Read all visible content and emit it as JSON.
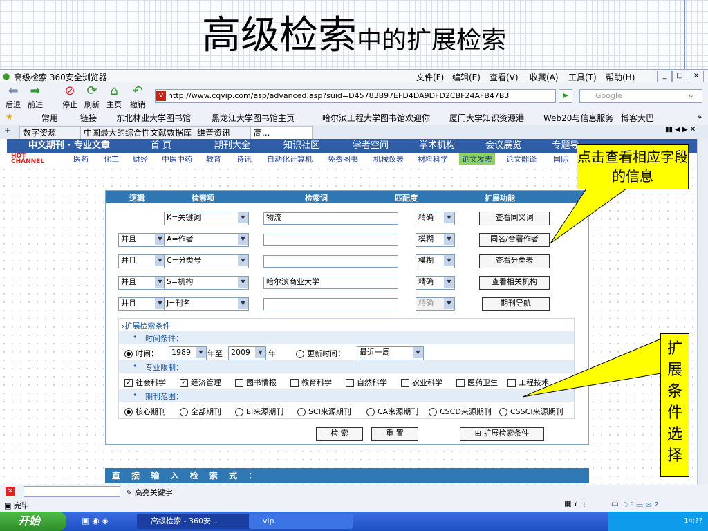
{
  "slide": {
    "title_big": "高级检索",
    "title_small": "中的扩展检索"
  },
  "window": {
    "icon": "leaf-icon",
    "title": "高级检索  360安全浏览器",
    "menus": [
      "文件(F)",
      "编辑(E)",
      "查看(V)",
      "收藏(A)",
      "工具(T)",
      "帮助(H)"
    ],
    "controls": [
      "_",
      "□",
      "×"
    ]
  },
  "toolbar": {
    "buttons": [
      "后退",
      "前进",
      "停止",
      "刷新",
      "主页",
      "撤销"
    ],
    "address": "http://www.cqvip.com/asp/advanced.asp?suid=D45783B97EFD4DA9DFD2CBF24AFB47B3",
    "search_placeholder": "Google"
  },
  "bookmarks": [
    "常用",
    "链接",
    "东北林业大学图书馆",
    "黑龙江大学图书馆主页",
    "哈尔滨工程大学图书馆欢迎你",
    "厦门大学知识资源港",
    "Web20与信息服务",
    "博客大巴"
  ],
  "tabs": [
    "数字资源",
    "中国最大的综合性文献数据库 -维普资讯",
    "高..."
  ],
  "site": {
    "logo": "中文期刊 · 专业文章",
    "nav": [
      "首 页",
      "期刊大全",
      "知识社区",
      "学者空间",
      "学术机构",
      "会议展览",
      "专题导"
    ],
    "hot": "HOT CHANNEL",
    "categories": [
      "医药",
      "化工",
      "财经",
      "中医中药",
      "教育",
      "诗讯",
      "自动化计算机",
      "免费图书",
      "机械仪表",
      "材料科学",
      "论文发表",
      "论文翻译",
      "国际"
    ]
  },
  "form": {
    "headers": [
      "逻辑",
      "检索项",
      "检索词",
      "匹配度",
      "扩展功能"
    ],
    "rows": [
      {
        "logic": "",
        "field": "K=关键词",
        "term": "物流",
        "match": "精确",
        "action": "查看同义词"
      },
      {
        "logic": "并且",
        "field": "A=作者",
        "term": "",
        "match": "模糊",
        "action": "同名/合著作者"
      },
      {
        "logic": "并且",
        "field": "C=分类号",
        "term": "",
        "match": "模糊",
        "action": "查看分类表"
      },
      {
        "logic": "并且",
        "field": "S=机构",
        "term": "哈尔滨商业大学",
        "match": "精确",
        "action": "查看相关机构"
      },
      {
        "logic": "并且",
        "field": "J=刊名",
        "term": "",
        "match": "精确",
        "action": "期刊导航"
      }
    ],
    "ext_title": "扩展检索条件",
    "time_label": "时间条件：",
    "time_prefix": "时间：",
    "year_from": "1989",
    "year_to_label": "年至",
    "year_to": "2009",
    "year_suffix": "年",
    "update_label": "更新时间：",
    "update_value": "最近一周",
    "subject_label": "专业限制：",
    "subjects": [
      {
        "label": "社会科学",
        "checked": true
      },
      {
        "label": "经济管理",
        "checked": true
      },
      {
        "label": "图书情报",
        "checked": false
      },
      {
        "label": "教育科学",
        "checked": false
      },
      {
        "label": "自然科学",
        "checked": false
      },
      {
        "label": "农业科学",
        "checked": false
      },
      {
        "label": "医药卫生",
        "checked": false
      },
      {
        "label": "工程技术",
        "checked": false
      }
    ],
    "journal_label": "期刊范围：",
    "journals": [
      "核心期刊",
      "全部期刊",
      "EI来源期刊",
      "SCI来源期刊",
      "CA来源期刊",
      "CSCD来源期刊",
      "CSSCI来源期刊"
    ],
    "journal_selected": 0,
    "search_btn": "检 索",
    "reset_btn": "重 置",
    "ext_btn": "扩展检索条件",
    "direct_label": "直 接 输 入 检 索 式 ："
  },
  "callouts": {
    "fields": "点击查看相应字段的信息",
    "ext": "扩展条件选择"
  },
  "findbar": {
    "label": "高亮关键字"
  },
  "status": {
    "text": "完毕"
  },
  "taskbar": {
    "start": "开始",
    "tasks": [
      "高级检索 - 360安...",
      "vip"
    ],
    "clock": "14:??"
  }
}
